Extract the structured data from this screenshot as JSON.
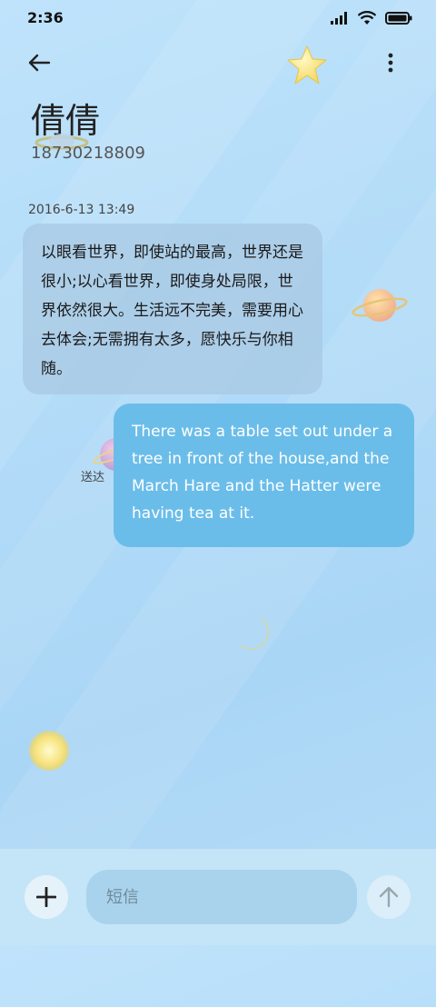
{
  "status_bar": {
    "time": "2:36",
    "icons": [
      "signal-icon",
      "wifi-icon",
      "battery-icon"
    ]
  },
  "toolbar": {
    "back_icon": "back-arrow-icon",
    "more_icon": "more-vert-icon"
  },
  "contact": {
    "name": "倩倩",
    "number": "18730218809"
  },
  "conversation": {
    "timestamp": "2016-6-13 13:49",
    "incoming_message": "以眼看世界，即使站的最高，世界还是很小;以心看世界，即使身处局限，世界依然很大。生活远不完美，需要用心去体会;无需拥有太多，愿快乐与你相随。",
    "outgoing_message": "There was a table set out under a tree in front of the house,and the March Hare and the Hatter were having tea at it.",
    "outgoing_status": "送达"
  },
  "composer": {
    "add_icon": "plus-icon",
    "placeholder": "短信",
    "value": "",
    "send_icon": "arrow-up-icon"
  },
  "colors": {
    "background": "#b3dcf8",
    "incoming_bubble": "#a8c8e2",
    "outgoing_bubble": "#6bbde9",
    "composer_bar": "#c4e5f7"
  },
  "decorations": [
    "star-icon",
    "planet-icon",
    "moon-icon",
    "sun-icon"
  ]
}
